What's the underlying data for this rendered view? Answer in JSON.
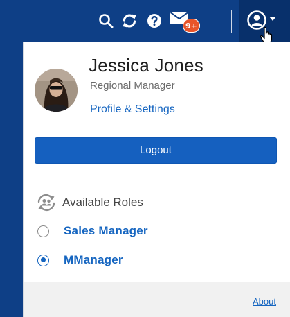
{
  "topbar": {
    "icons": {
      "search": "search-icon",
      "refresh": "refresh-icon",
      "help": "help-icon",
      "mail": "mail-icon",
      "user": "user-icon"
    },
    "mail_badge": "9+",
    "colors": {
      "bar": "#0e3f86",
      "user_button": "#08306b",
      "badge": "#e8542a"
    }
  },
  "profile": {
    "name": "Jessica Jones",
    "role": "Regional Manager",
    "settings_link": "Profile & Settings"
  },
  "logout": {
    "label": "Logout",
    "color": "#1560bf"
  },
  "roles": {
    "title": "Available Roles",
    "items": [
      {
        "label": "Sales Manager",
        "selected": false
      },
      {
        "label": "MManager",
        "selected": true
      }
    ]
  },
  "footer": {
    "about_link": "About"
  }
}
